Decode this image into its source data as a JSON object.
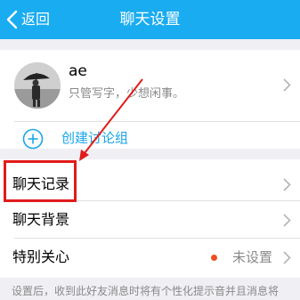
{
  "topbar": {
    "back_label": "返回",
    "title": "聊天设置",
    "background": "#19acf0"
  },
  "profile": {
    "name": "ae",
    "signature": "只管写字，少想闲事。"
  },
  "create_group": {
    "label": "创建讨论组",
    "color": "#19a6ea"
  },
  "settings": {
    "chat_history": "聊天记录",
    "chat_background": "聊天背景",
    "special_care": "特别关心",
    "special_care_status": "未设置"
  },
  "footer": {
    "note": "设置后，收到此好友消息时将有个性化提示音并且消息将"
  },
  "annotation": {
    "color": "#e11b1b"
  },
  "icons": [
    "chevron-left-icon",
    "chevron-right-icon",
    "plus-circle-icon",
    "avatar"
  ]
}
